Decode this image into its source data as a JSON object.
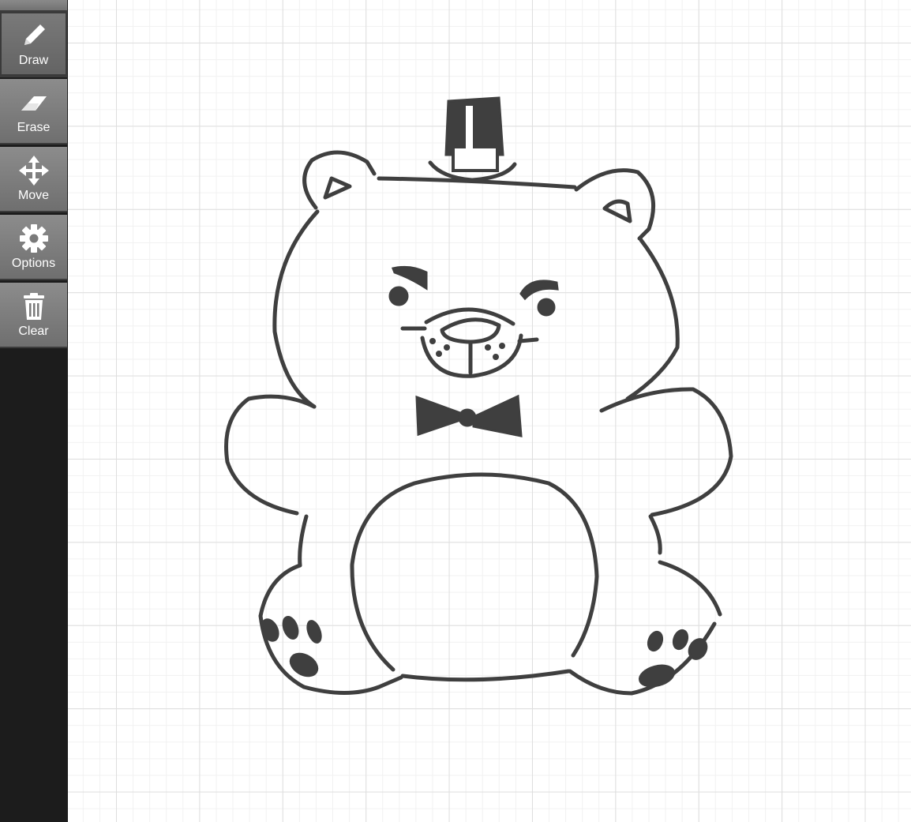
{
  "toolbar": {
    "draw": {
      "label": "Draw",
      "icon": "pencil-icon",
      "active": true
    },
    "erase": {
      "label": "Erase",
      "icon": "eraser-icon"
    },
    "move": {
      "label": "Move",
      "icon": "move-arrows-icon"
    },
    "options": {
      "label": "Options",
      "icon": "gear-icon"
    },
    "clear": {
      "label": "Clear",
      "icon": "trash-icon"
    }
  },
  "canvas": {
    "background": "#ffffff",
    "grid_color": "#dedede",
    "stroke_color": "#3f3f3f"
  }
}
